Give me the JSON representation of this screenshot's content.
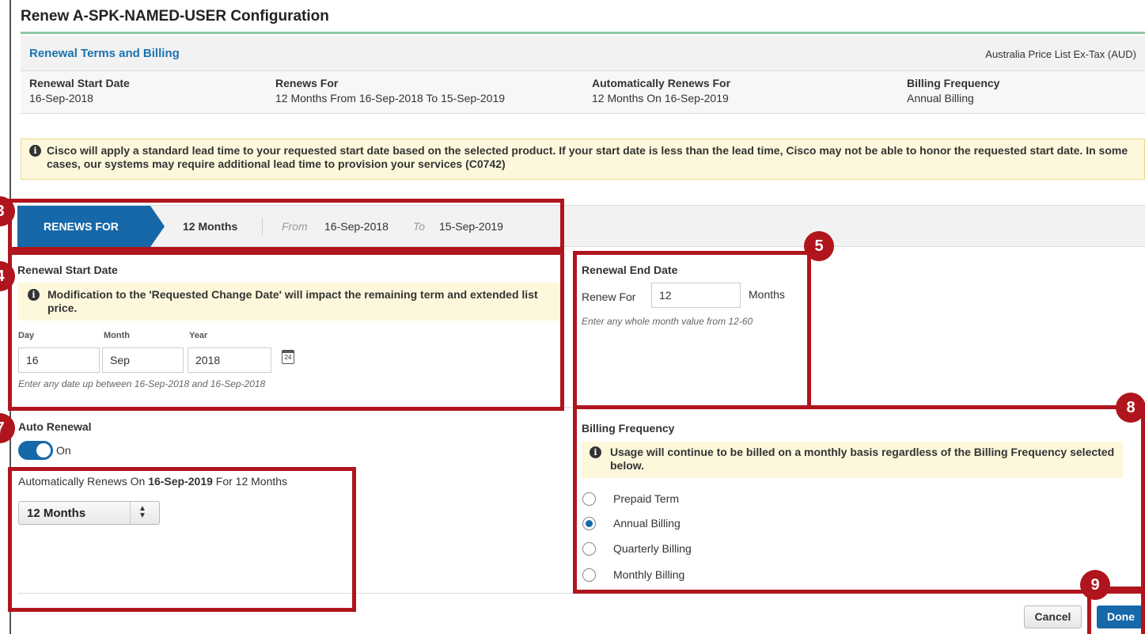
{
  "dialog": {
    "title": "Renew A-SPK-NAMED-USER Configuration"
  },
  "terms": {
    "title": "Renewal Terms and Billing",
    "price_list": "Australia Price List Ex-Tax (AUD)"
  },
  "summary": {
    "start_label": "Renewal Start Date",
    "start_value": "16-Sep-2018",
    "renews_label": "Renews For",
    "renews_value": "12 Months From 16-Sep-2018 To 15-Sep-2019",
    "auto_label": "Automatically Renews For",
    "auto_value": "12 Months On 16-Sep-2019",
    "billing_label": "Billing Frequency",
    "billing_value": "Annual Billing"
  },
  "notice_top": {
    "text": "Cisco will apply a standard lead time to your requested start date based on the selected product. If your start date is less than the lead time, Cisco may not be able to honor the requested start date. In some cases, our systems may require additional lead time to provision your services (C0742)"
  },
  "renews_bar": {
    "label": "RENEWS FOR",
    "months": "12 Months",
    "from_label": "From",
    "from_date": "16-Sep-2018",
    "to_label": "To",
    "to_date": "15-Sep-2019"
  },
  "start_section": {
    "heading": "Renewal Start Date",
    "notice": "Modification to the 'Requested Change Date' will impact the remaining term and extended list price.",
    "day_label": "Day",
    "month_label": "Month",
    "year_label": "Year",
    "day_value": "16",
    "month_value": "Sep",
    "year_value": "2018",
    "calendar_day": "24",
    "hint": "Enter any date up between 16-Sep-2018 and 16-Sep-2018"
  },
  "end_section": {
    "heading": "Renewal End Date",
    "renew_for_label": "Renew For",
    "renew_for_value": "12",
    "unit": "Months",
    "hint": "Enter any whole month value from 12-60"
  },
  "auto_renewal": {
    "heading": "Auto Renewal",
    "toggle_state": "On",
    "line_prefix": "Automatically Renews On ",
    "line_date": "16-Sep-2019",
    "line_suffix": " For 12 Months",
    "select_value": "12 Months"
  },
  "billing": {
    "heading": "Billing Frequency",
    "notice": "Usage will continue to be billed on a monthly basis regardless of the Billing Frequency selected below.",
    "options": [
      {
        "label": "Prepaid Term",
        "checked": false
      },
      {
        "label": "Annual Billing",
        "checked": true
      },
      {
        "label": "Quarterly Billing",
        "checked": false
      },
      {
        "label": "Monthly Billing",
        "checked": false
      }
    ]
  },
  "buttons": {
    "cancel": "Cancel",
    "done": "Done"
  },
  "callouts": {
    "badge_5": "5",
    "badge_8": "8",
    "badge_9": "9",
    "badge_3": "3",
    "badge_4": "4",
    "badge_7": "7"
  },
  "colors": {
    "accent": "#1668a8",
    "callout": "#b0151d",
    "notice_bg": "#fdf8dc"
  }
}
